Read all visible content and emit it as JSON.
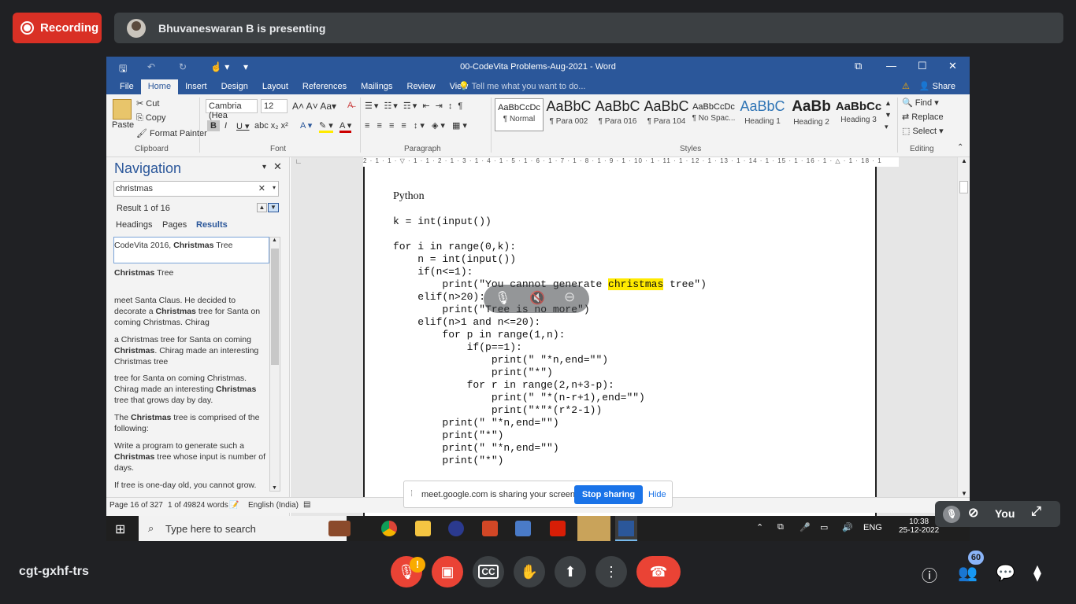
{
  "meet": {
    "recording_label": "Recording",
    "presenting_label": "Bhuvaneswaran B is presenting",
    "meeting_code": "cgt-gxhf-trs",
    "self_label": "You",
    "participants_count": "60",
    "share_notice": "meet.google.com is sharing your screen.",
    "stop_sharing": "Stop sharing",
    "hide": "Hide",
    "alert_mark": "!"
  },
  "word": {
    "title": "00-CodeVita Problems-Aug-2021  -  Word",
    "tabs": [
      "File",
      "Home",
      "Insert",
      "Design",
      "Layout",
      "References",
      "Mailings",
      "Review",
      "View"
    ],
    "active_tab": "Home",
    "tell_me": "Tell me what you want to do...",
    "share": "Share",
    "clipboard": {
      "paste": "Paste",
      "cut": "Cut",
      "copy": "Copy",
      "format_painter": "Format Painter",
      "group": "Clipboard"
    },
    "font": {
      "family": "Cambria (Hea",
      "size": "12",
      "group": "Font"
    },
    "paragraph_group": "Paragraph",
    "styles": [
      {
        "preview": "AaBbCcDc",
        "name": "¶ Normal"
      },
      {
        "preview": "AaBbC",
        "name": "¶ Para 002"
      },
      {
        "preview": "AaBbC",
        "name": "¶ Para 016"
      },
      {
        "preview": "AaBbC",
        "name": "¶ Para 104"
      },
      {
        "preview": "AaBbCcDc",
        "name": "¶ No Spac..."
      },
      {
        "preview": "AaBbC",
        "name": "Heading 1"
      },
      {
        "preview": "AaBb",
        "name": "Heading 2"
      },
      {
        "preview": "AaBbCc",
        "name": "Heading 3"
      }
    ],
    "styles_group": "Styles",
    "editing": {
      "find": "Find",
      "replace": "Replace",
      "select": "Select",
      "group": "Editing"
    },
    "navigation": {
      "title": "Navigation",
      "search_value": "christmas",
      "result_count": "Result 1 of 16",
      "tabs": [
        "Headings",
        "Pages",
        "Results"
      ],
      "active_tab": "Results",
      "results": [
        {
          "pre": "CodeVita 2016, ",
          "bold": "Christmas",
          "post": " Tree"
        },
        {
          "pre": "",
          "bold": "Christmas",
          "post": " Tree"
        },
        {
          "pre": "meet Santa Claus. He decided to decorate a ",
          "bold": "Christmas",
          "post": " tree for Santa on coming Christmas. Chirag"
        },
        {
          "pre": "a Christmas tree for Santa on coming ",
          "bold": "Christmas",
          "post": ". Chirag made an interesting Christmas tree"
        },
        {
          "pre": "tree for Santa on coming Christmas. Chirag made an interesting ",
          "bold": "Christmas",
          "post": " tree that grows day by day."
        },
        {
          "pre": "The ",
          "bold": "Christmas",
          "post": " tree is comprised of the following:"
        },
        {
          "pre": "Write a program to generate such a ",
          "bold": "Christmas",
          "post": " tree whose input is number of days."
        },
        {
          "pre": "If tree is one-day old, you cannot grow.",
          "bold": "",
          "post": ""
        }
      ]
    },
    "ruler_text": "2 · 1 · 1 · ▽ · 1 · 1 · 2 · 1 · 3 · 1 · 4 · 1 · 5 · 1 · 6 · 1 · 7 · 1 · 8 · 1 · 9 · 1 · 10 · 1 · 11 · 1 · 12 · 1 · 13 · 1 · 14 · 1 · 15 · 1 · 16 · 1 · △ · 1 · 18 · 1",
    "document": {
      "heading": "Python",
      "lines": [
        "k = int(input())",
        "",
        "for i in range(0,k):",
        "    n = int(input())",
        "    if(n<=1):",
        "        print(\"You cannot generate christmas tree\")",
        "    elif(n>20):",
        "        print(\"Tree is no more\")",
        "    elif(n>1 and n<=20):",
        "        for p in range(1,n):",
        "            if(p==1):",
        "                print(\" \"*n,end=\"\")",
        "                print(\"*\")",
        "            for r in range(2,n+3-p):",
        "                print(\" \"*(n-r+1),end=\"\")",
        "                print(\"*\"*(r*2-1))",
        "        print(\" \"*n,end=\"\")",
        "        print(\"*\")",
        "        print(\" \"*n,end=\"\")",
        "        print(\"*\")"
      ]
    },
    "status": {
      "page": "Page 16 of 327",
      "words": "1 of 49824 words",
      "language": "English (India)"
    }
  },
  "taskbar": {
    "search_placeholder": "Type here to search",
    "lang": "ENG",
    "time": "10:38",
    "date": "25-12-2022"
  },
  "colors": {
    "word_blue": "#2b579a",
    "meet_red": "#ea4335",
    "meet_bg": "#202124",
    "highlight": "#ffea00"
  }
}
